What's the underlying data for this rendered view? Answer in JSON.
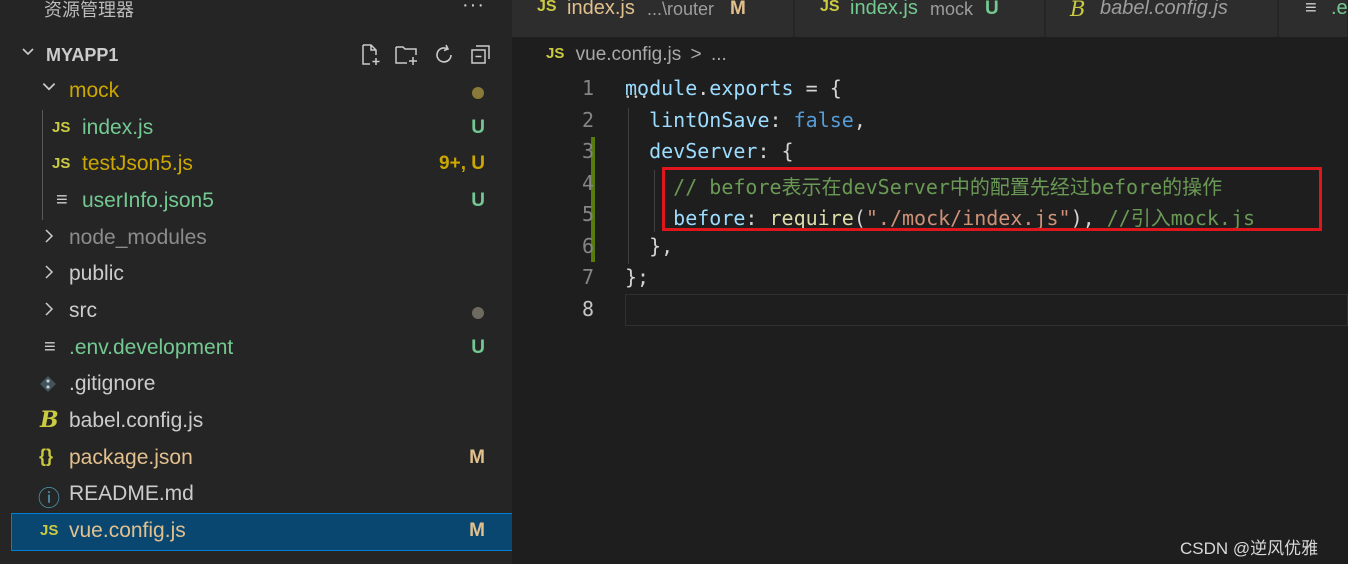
{
  "explorer": {
    "title": "资源管理器",
    "more": "···",
    "project": "MYAPP1",
    "items": [
      {
        "label": "mock",
        "icon": "chevron-down-icon",
        "glyph": "⌄",
        "badge": "",
        "dot": true,
        "color": "#cca700"
      },
      {
        "label": "index.js",
        "icon": "js-file-icon",
        "glyph": "JS",
        "badge": "U",
        "color": "#73c991"
      },
      {
        "label": "testJson5.js",
        "icon": "js-file-icon",
        "glyph": "JS",
        "badge": "9+, U",
        "color": "#cca700"
      },
      {
        "label": "userInfo.json5",
        "icon": "text-file-icon",
        "glyph": "≡",
        "badge": "U",
        "color": "#73c991"
      },
      {
        "label": "node_modules",
        "icon": "chevron-right-icon",
        "glyph": "›",
        "badge": "",
        "color": "#8c8c8c"
      },
      {
        "label": "public",
        "icon": "chevron-right-icon",
        "glyph": "›",
        "badge": "",
        "color": "#cccccc"
      },
      {
        "label": "src",
        "icon": "chevron-right-icon",
        "glyph": "›",
        "badge": "",
        "dot": true,
        "color": "#cccccc"
      },
      {
        "label": ".env.development",
        "icon": "text-file-icon",
        "glyph": "≡",
        "badge": "U",
        "color": "#73c991"
      },
      {
        "label": ".gitignore",
        "icon": "git-icon",
        "glyph": "◆",
        "badge": "",
        "color": "#cccccc"
      },
      {
        "label": "babel.config.js",
        "icon": "babel-icon",
        "glyph": "B",
        "badge": "",
        "color": "#cccccc"
      },
      {
        "label": "package.json",
        "icon": "json-icon",
        "glyph": "{}",
        "badge": "M",
        "color": "#e2c08d"
      },
      {
        "label": "README.md",
        "icon": "info-icon",
        "glyph": "ⓘ",
        "badge": "",
        "color": "#cccccc"
      },
      {
        "label": "vue.config.js",
        "icon": "js-file-icon",
        "glyph": "JS",
        "badge": "M",
        "color": "#e2c08d"
      }
    ]
  },
  "tabs": [
    {
      "icon": "JS",
      "name": "index.js",
      "path": "...\\router",
      "status": "M"
    },
    {
      "icon": "JS",
      "name": "index.js",
      "path": "mock",
      "status": "U"
    },
    {
      "icon": "B",
      "name": "babel.config.js",
      "path": "",
      "status": ""
    },
    {
      "icon": "≡",
      "name": ".e",
      "path": "",
      "status": ""
    }
  ],
  "breadcrumb": {
    "icon": "JS",
    "file": "vue.config.js",
    "sep": ">",
    "rest": "..."
  },
  "editor": {
    "line_numbers": [
      "1",
      "2",
      "3",
      "4",
      "5",
      "6",
      "7",
      "8"
    ],
    "lines": [
      [
        {
          "t": "module",
          "c": "var"
        },
        {
          "t": ".",
          "c": "pun"
        },
        {
          "t": "exports",
          "c": "var"
        },
        {
          "t": " = {",
          "c": "pun"
        }
      ],
      [
        {
          "t": "  ",
          "c": "pun"
        },
        {
          "t": "lintOnSave",
          "c": "var"
        },
        {
          "t": ": ",
          "c": "pun"
        },
        {
          "t": "false",
          "c": "kw"
        },
        {
          "t": ",",
          "c": "pun"
        }
      ],
      [
        {
          "t": "  ",
          "c": "pun"
        },
        {
          "t": "devServer",
          "c": "var"
        },
        {
          "t": ": {",
          "c": "pun"
        }
      ],
      [
        {
          "t": "    ",
          "c": "pun"
        },
        {
          "t": "// before表示在devServer中的配置先经过before的操作",
          "c": "cmt"
        }
      ],
      [
        {
          "t": "    ",
          "c": "pun"
        },
        {
          "t": "before",
          "c": "var"
        },
        {
          "t": ": ",
          "c": "pun"
        },
        {
          "t": "require",
          "c": "fn"
        },
        {
          "t": "(",
          "c": "pun"
        },
        {
          "t": "\"./mock/index.js\"",
          "c": "str"
        },
        {
          "t": "), ",
          "c": "pun"
        },
        {
          "t": "//引入mock.js",
          "c": "cmt"
        }
      ],
      [
        {
          "t": "  ",
          "c": "pun"
        },
        {
          "t": "},",
          "c": "pun"
        }
      ],
      [
        {
          "t": "};",
          "c": "pun"
        }
      ],
      []
    ]
  },
  "watermark": "CSDN @逆风优雅",
  "colors": {
    "selected_bg": "#094771",
    "highlight_border": "#e0161d",
    "js_icon": "#cbcb41"
  }
}
